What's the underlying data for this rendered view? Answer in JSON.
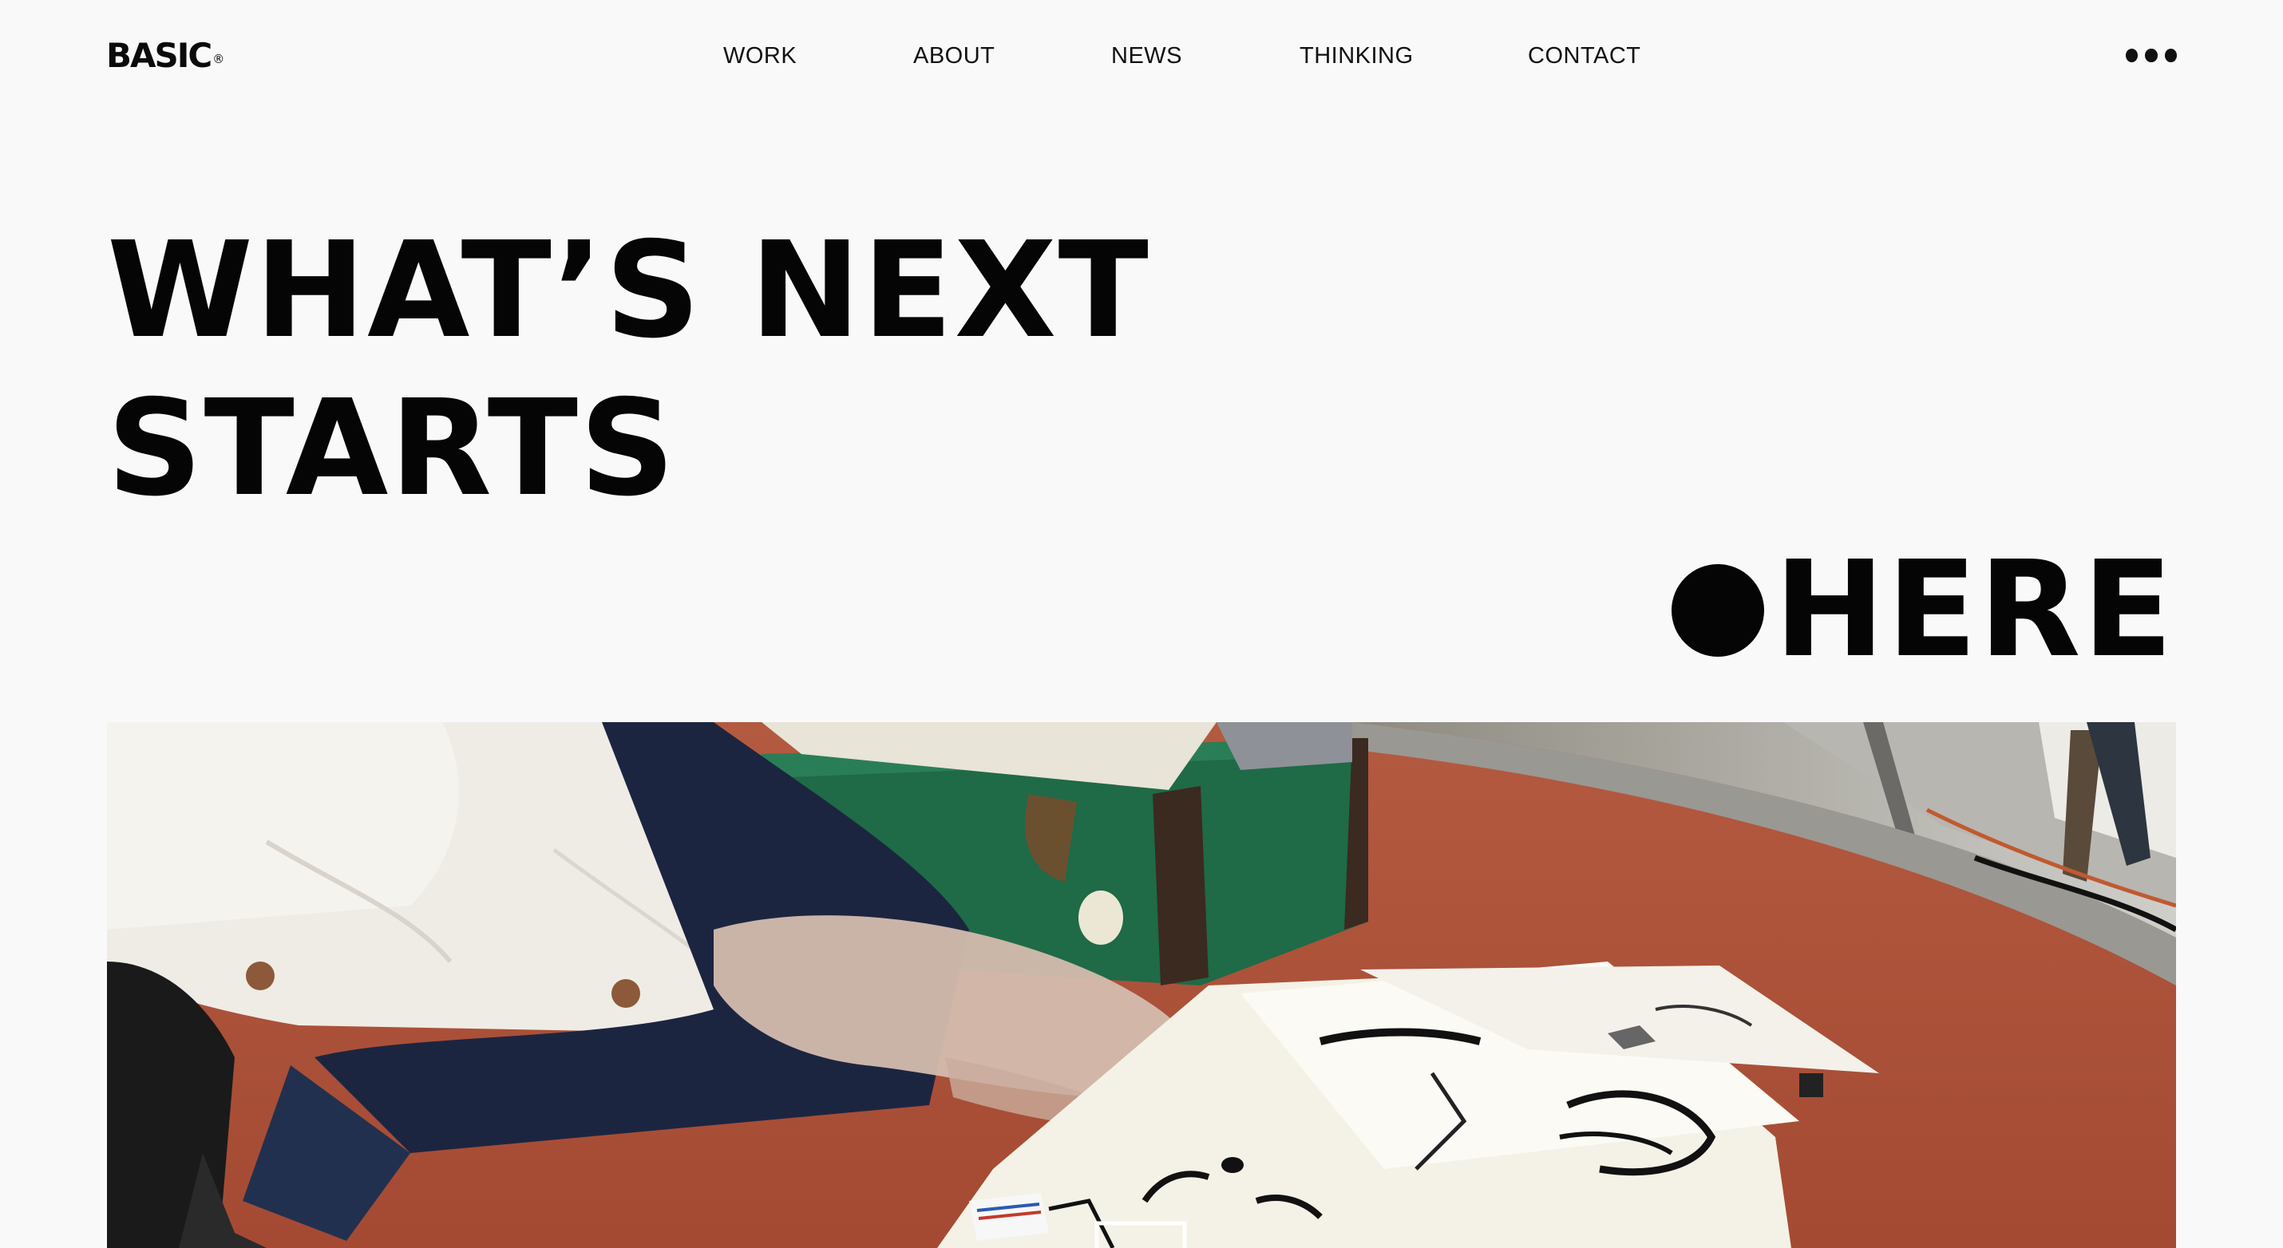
{
  "header": {
    "logo_text": "BASIC",
    "logo_mark": "®",
    "nav": [
      {
        "label": "WORK"
      },
      {
        "label": "ABOUT"
      },
      {
        "label": "NEWS"
      },
      {
        "label": "THINKING"
      },
      {
        "label": "CONTACT"
      }
    ],
    "menu_icon": "more-dots-icon"
  },
  "hero": {
    "line1": "WHAT’S NEXT",
    "line2": "STARTS",
    "line3": "HERE",
    "dot_icon": "filled-circle-icon"
  },
  "media": {
    "type": "video",
    "description_icon": "video-frame"
  },
  "colors": {
    "background": "#f9f9f9",
    "text": "#0b0b0b",
    "floor": "#ad4e37",
    "trunk": "#1f6a47"
  }
}
